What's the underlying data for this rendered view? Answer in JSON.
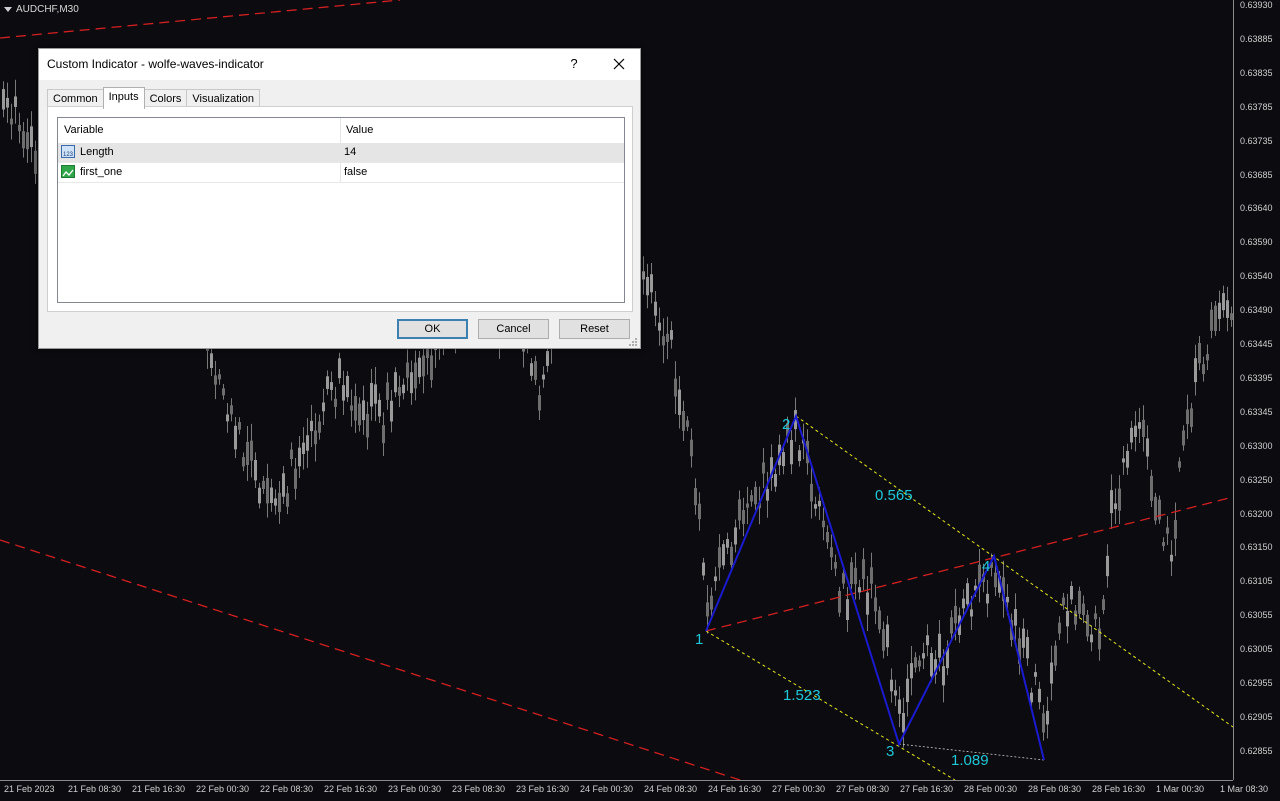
{
  "chart": {
    "symbol": "AUDCHF,M30",
    "price_labels": [
      "0.63930",
      "0.63885",
      "0.63835",
      "0.63785",
      "0.63735",
      "0.63685",
      "0.63640",
      "0.63590",
      "0.63540",
      "0.63490",
      "0.63445",
      "0.63395",
      "0.63345",
      "0.63300",
      "0.63250",
      "0.63200",
      "0.63150",
      "0.63105",
      "0.63055",
      "0.63005",
      "0.62955",
      "0.62905",
      "0.62855"
    ],
    "time_labels": [
      "21 Feb 2023",
      "21 Feb 08:30",
      "21 Feb 16:30",
      "22 Feb 00:30",
      "22 Feb 08:30",
      "22 Feb 16:30",
      "23 Feb 00:30",
      "23 Feb 08:30",
      "23 Feb 16:30",
      "24 Feb 00:30",
      "24 Feb 08:30",
      "24 Feb 16:30",
      "27 Feb 00:30",
      "27 Feb 08:30",
      "27 Feb 16:30",
      "28 Feb 00:30",
      "28 Feb 08:30",
      "28 Feb 16:30",
      "1 Mar 00:30",
      "1 Mar 08:30"
    ],
    "wave_points": [
      "1",
      "2",
      "3",
      "4"
    ],
    "ratios": [
      "0.565",
      "1.523",
      "1.089"
    ],
    "colors": {
      "background": "#0b0b10",
      "candles": "#8c8c8c",
      "wave_line": "#1a1ad0",
      "wave_labels": "#1fc8d8",
      "trend_line": "#d42020",
      "target_line": "#e8e820"
    }
  },
  "dialog": {
    "title": "Custom Indicator - wolfe-waves-indicator",
    "help": "?",
    "tabs": [
      {
        "label": "Common",
        "active": false
      },
      {
        "label": "Inputs",
        "active": true
      },
      {
        "label": "Colors",
        "active": false
      },
      {
        "label": "Visualization",
        "active": false
      }
    ],
    "columns": {
      "variable": "Variable",
      "value": "Value"
    },
    "params": [
      {
        "name": "Length",
        "value": "14",
        "icon": "integer-param-icon"
      },
      {
        "name": "first_one",
        "value": "false",
        "icon": "bool-param-icon"
      }
    ],
    "buttons": {
      "ok": "OK",
      "cancel": "Cancel",
      "reset": "Reset"
    }
  }
}
